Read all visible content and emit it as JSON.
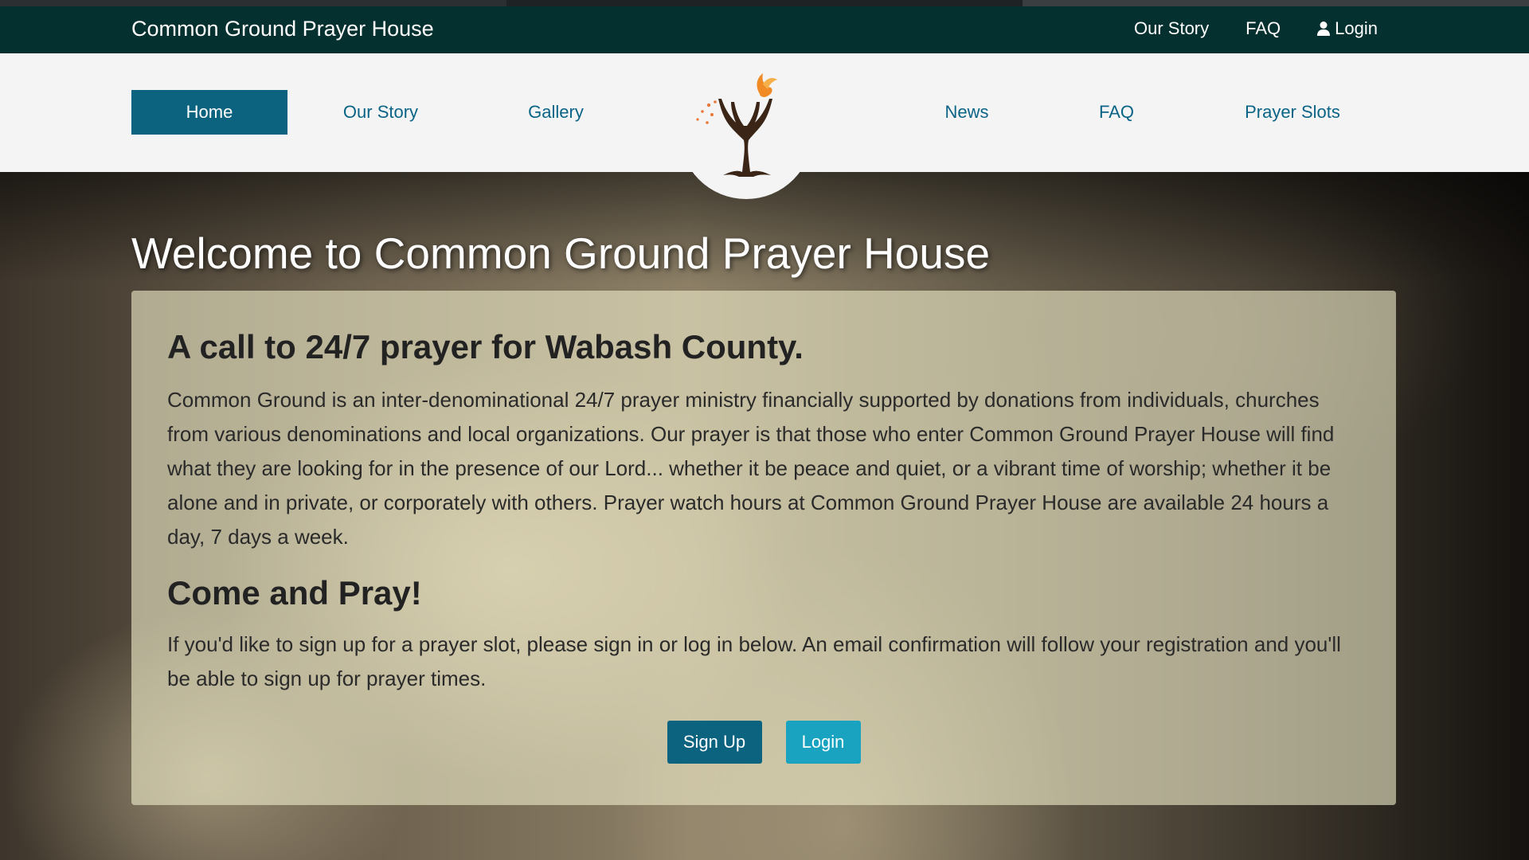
{
  "site": {
    "title": "Common Ground Prayer House"
  },
  "top_nav": {
    "our_story": "Our Story",
    "faq": "FAQ",
    "login": "Login"
  },
  "main_nav": {
    "home": "Home",
    "our_story": "Our Story",
    "gallery": "Gallery",
    "news": "News",
    "faq": "FAQ",
    "prayer_slots": "Prayer Slots",
    "active": "Home"
  },
  "hero": {
    "title": "Welcome to Common Ground Prayer House"
  },
  "card": {
    "heading": "A call to 24/7 prayer for Wabash County.",
    "intro": "Common Ground is an inter-denominational 24/7 prayer ministry financially supported by donations from individuals, churches from various denominations and local organizations. Our prayer is that those who enter Common Ground Prayer House will find what they are looking for in the presence of our Lord... whether it be peace and quiet, or a vibrant time of worship; whether it be alone and in private, or corporately with others.  Prayer watch hours at Common Ground Prayer House are available 24 hours a day, 7 days a week.",
    "subheading": "Come and Pray!",
    "signup_text": "If you'd like to sign up for a prayer slot, please sign in or log in below. An email confirmation will follow your registration and you'll be able to sign up for prayer times.",
    "signup_button": "Sign Up",
    "login_button": "Login"
  },
  "colors": {
    "topbar": "#04302f",
    "nav_active": "#0c6380",
    "nav_link": "#0b6486",
    "login_button": "#1aa3c0"
  },
  "icons": {
    "logo": "tree-hands-dove-logo",
    "login": "user-icon"
  }
}
